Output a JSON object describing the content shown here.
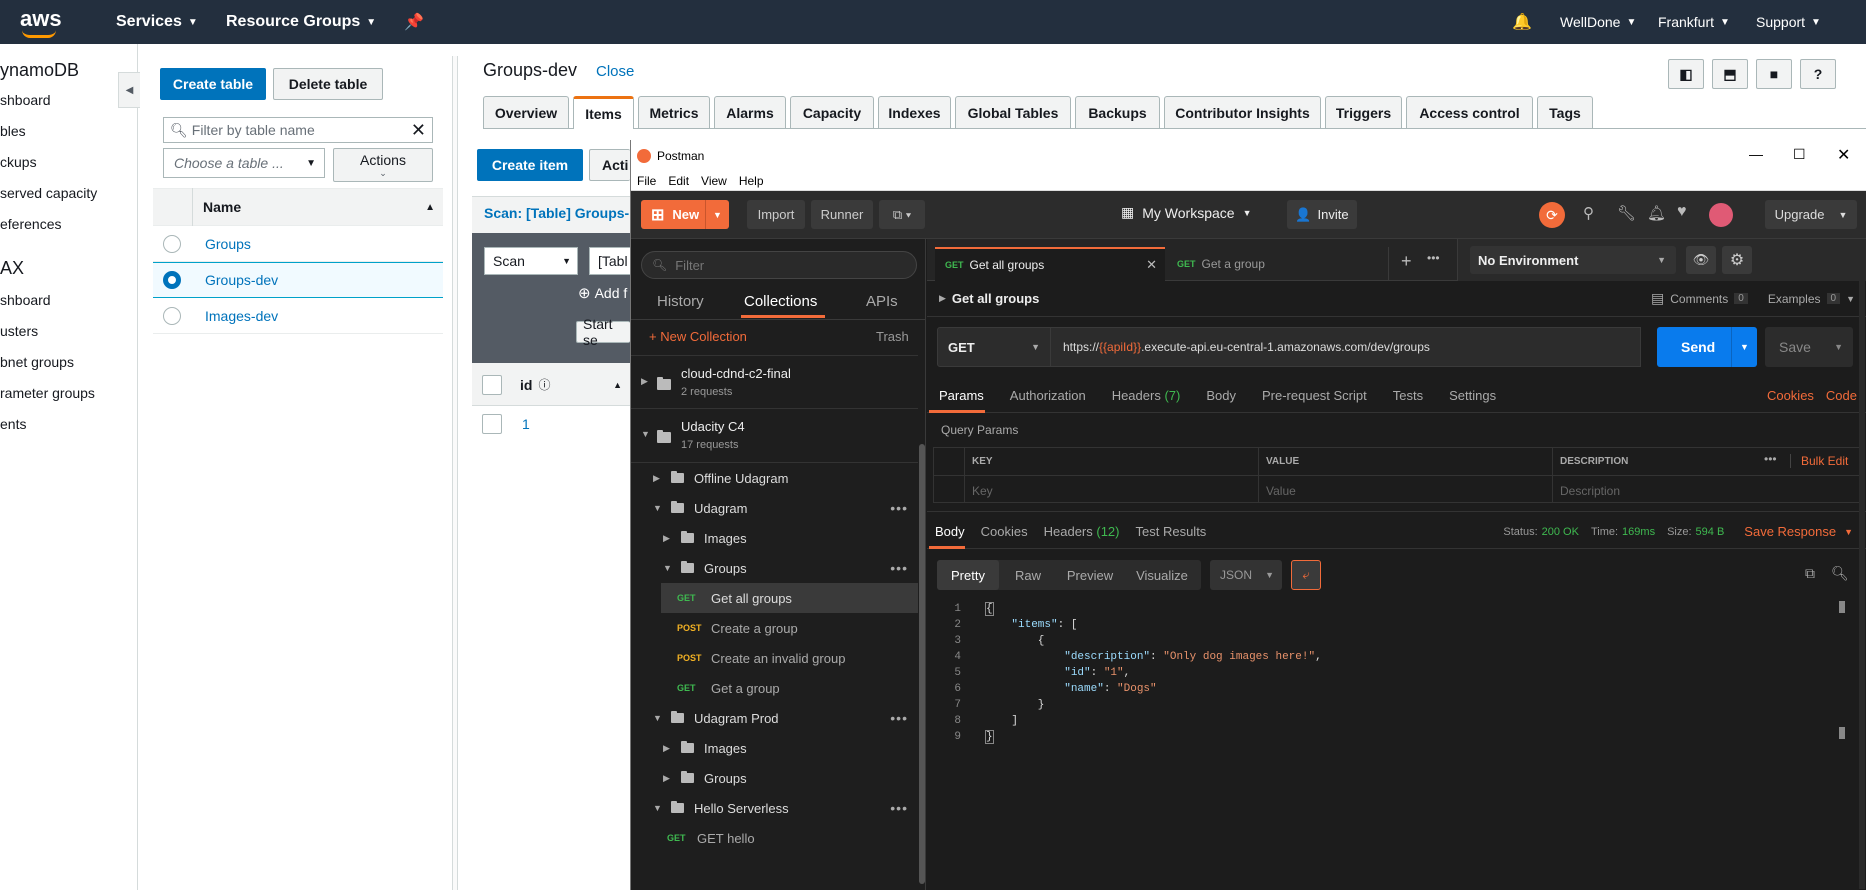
{
  "aws": {
    "logo": "aws",
    "nav": {
      "services": "Services",
      "resource_groups": "Resource Groups"
    },
    "right": {
      "account": "WellDone",
      "region": "Frankfurt",
      "support": "Support"
    }
  },
  "leftnav": {
    "header": "ynamoDB",
    "items": [
      "shboard",
      "bles",
      "ckups",
      "served capacity",
      "eferences"
    ],
    "dax_header": "AX",
    "dax_items": [
      "shboard",
      "usters",
      "bnet groups",
      "rameter groups",
      "ents"
    ]
  },
  "tables": {
    "create_label": "Create table",
    "delete_label": "Delete table",
    "filter_placeholder": "Filter by table name",
    "choose_placeholder": "Choose a table ...",
    "actions_label": "Actions",
    "name_header": "Name",
    "rows": [
      "Groups",
      "Groups-dev",
      "Images-dev"
    ]
  },
  "main": {
    "title": "Groups-dev",
    "close": "Close",
    "tabs": [
      "Overview",
      "Items",
      "Metrics",
      "Alarms",
      "Capacity",
      "Indexes",
      "Global Tables",
      "Backups",
      "Contributor Insights",
      "Triggers",
      "Access control",
      "Tags"
    ],
    "create_item": "Create item",
    "actions_trunc": "Acti",
    "scan_label": "Scan: [Table] Groups-",
    "scan_select": "Scan",
    "table_select": "[Tabl",
    "add_filter": "Add f",
    "start_search": "Start se",
    "col_id": "id",
    "row_id": "1"
  },
  "postman": {
    "title": "Postman",
    "menu": [
      "File",
      "Edit",
      "View",
      "Help"
    ],
    "new": "New",
    "import": "Import",
    "runner": "Runner",
    "workspace": "My Workspace",
    "invite": "Invite",
    "upgrade": "Upgrade",
    "filter_placeholder": "Filter",
    "sidebar_tabs": [
      "History",
      "Collections",
      "APIs"
    ],
    "new_collection": "+ New Collection",
    "trash": "Trash",
    "collections": [
      {
        "name": "cloud-cdnd-c2-final",
        "count": "2 requests"
      },
      {
        "name": "Udacity C4",
        "count": "17 requests"
      }
    ],
    "tree": {
      "offline": "Offline Udagram",
      "udagram": "Udagram",
      "images": "Images",
      "groups": "Groups",
      "req1": {
        "method": "GET",
        "name": "Get all groups"
      },
      "req2": {
        "method": "POST",
        "name": "Create a group"
      },
      "req3": {
        "method": "POST",
        "name": "Create an invalid group"
      },
      "req4": {
        "method": "GET",
        "name": "Get a group"
      },
      "prod": "Udagram Prod",
      "prod_images": "Images",
      "prod_groups": "Groups",
      "hello": "Hello Serverless",
      "hello_req": {
        "method": "GET",
        "name": "GET hello"
      }
    },
    "tabs": [
      {
        "method": "GET",
        "name": "Get all groups"
      },
      {
        "method": "GET",
        "name": "Get a group"
      }
    ],
    "environment": "No Environment",
    "request_name": "Get all groups",
    "comments": "Comments",
    "comments_count": "0",
    "examples": "Examples",
    "examples_count": "0",
    "method": "GET",
    "url_prefix": "https://",
    "url_var": "{{apiId}}",
    "url_suffix": ".execute-api.eu-central-1.amazonaws.com/dev/groups",
    "send": "Send",
    "save": "Save",
    "req_tabs": [
      "Params",
      "Authorization",
      "Headers",
      "Body",
      "Pre-request Script",
      "Tests",
      "Settings"
    ],
    "headers_count": "(7)",
    "cookies": "Cookies",
    "code": "Code",
    "query_params": "Query Params",
    "cols": [
      "KEY",
      "VALUE",
      "DESCRIPTION"
    ],
    "bulk_edit": "Bulk Edit",
    "ph": [
      "Key",
      "Value",
      "Description"
    ],
    "resp_tabs": [
      "Body",
      "Cookies",
      "Headers",
      "Test Results"
    ],
    "resp_headers_count": "(12)",
    "status_label": "Status:",
    "status": "200 OK",
    "time_label": "Time:",
    "time": "169ms",
    "size_label": "Size:",
    "size": "594 B",
    "save_response": "Save Response",
    "view_tabs": [
      "Pretty",
      "Raw",
      "Preview",
      "Visualize"
    ],
    "format": "JSON",
    "body_lines": [
      "{",
      "    \"items\": [",
      "        {",
      "            \"description\": \"Only dog images here!\",",
      "            \"id\": \"1\",",
      "            \"name\": \"Dogs\"",
      "        }",
      "    ]",
      "}"
    ]
  },
  "colors": {
    "aws_nav": "#232f3e",
    "aws_orange": "#ff9900",
    "aws_blue": "#0073bb",
    "postman_orange": "#f26b3a",
    "postman_send": "#097bed"
  }
}
